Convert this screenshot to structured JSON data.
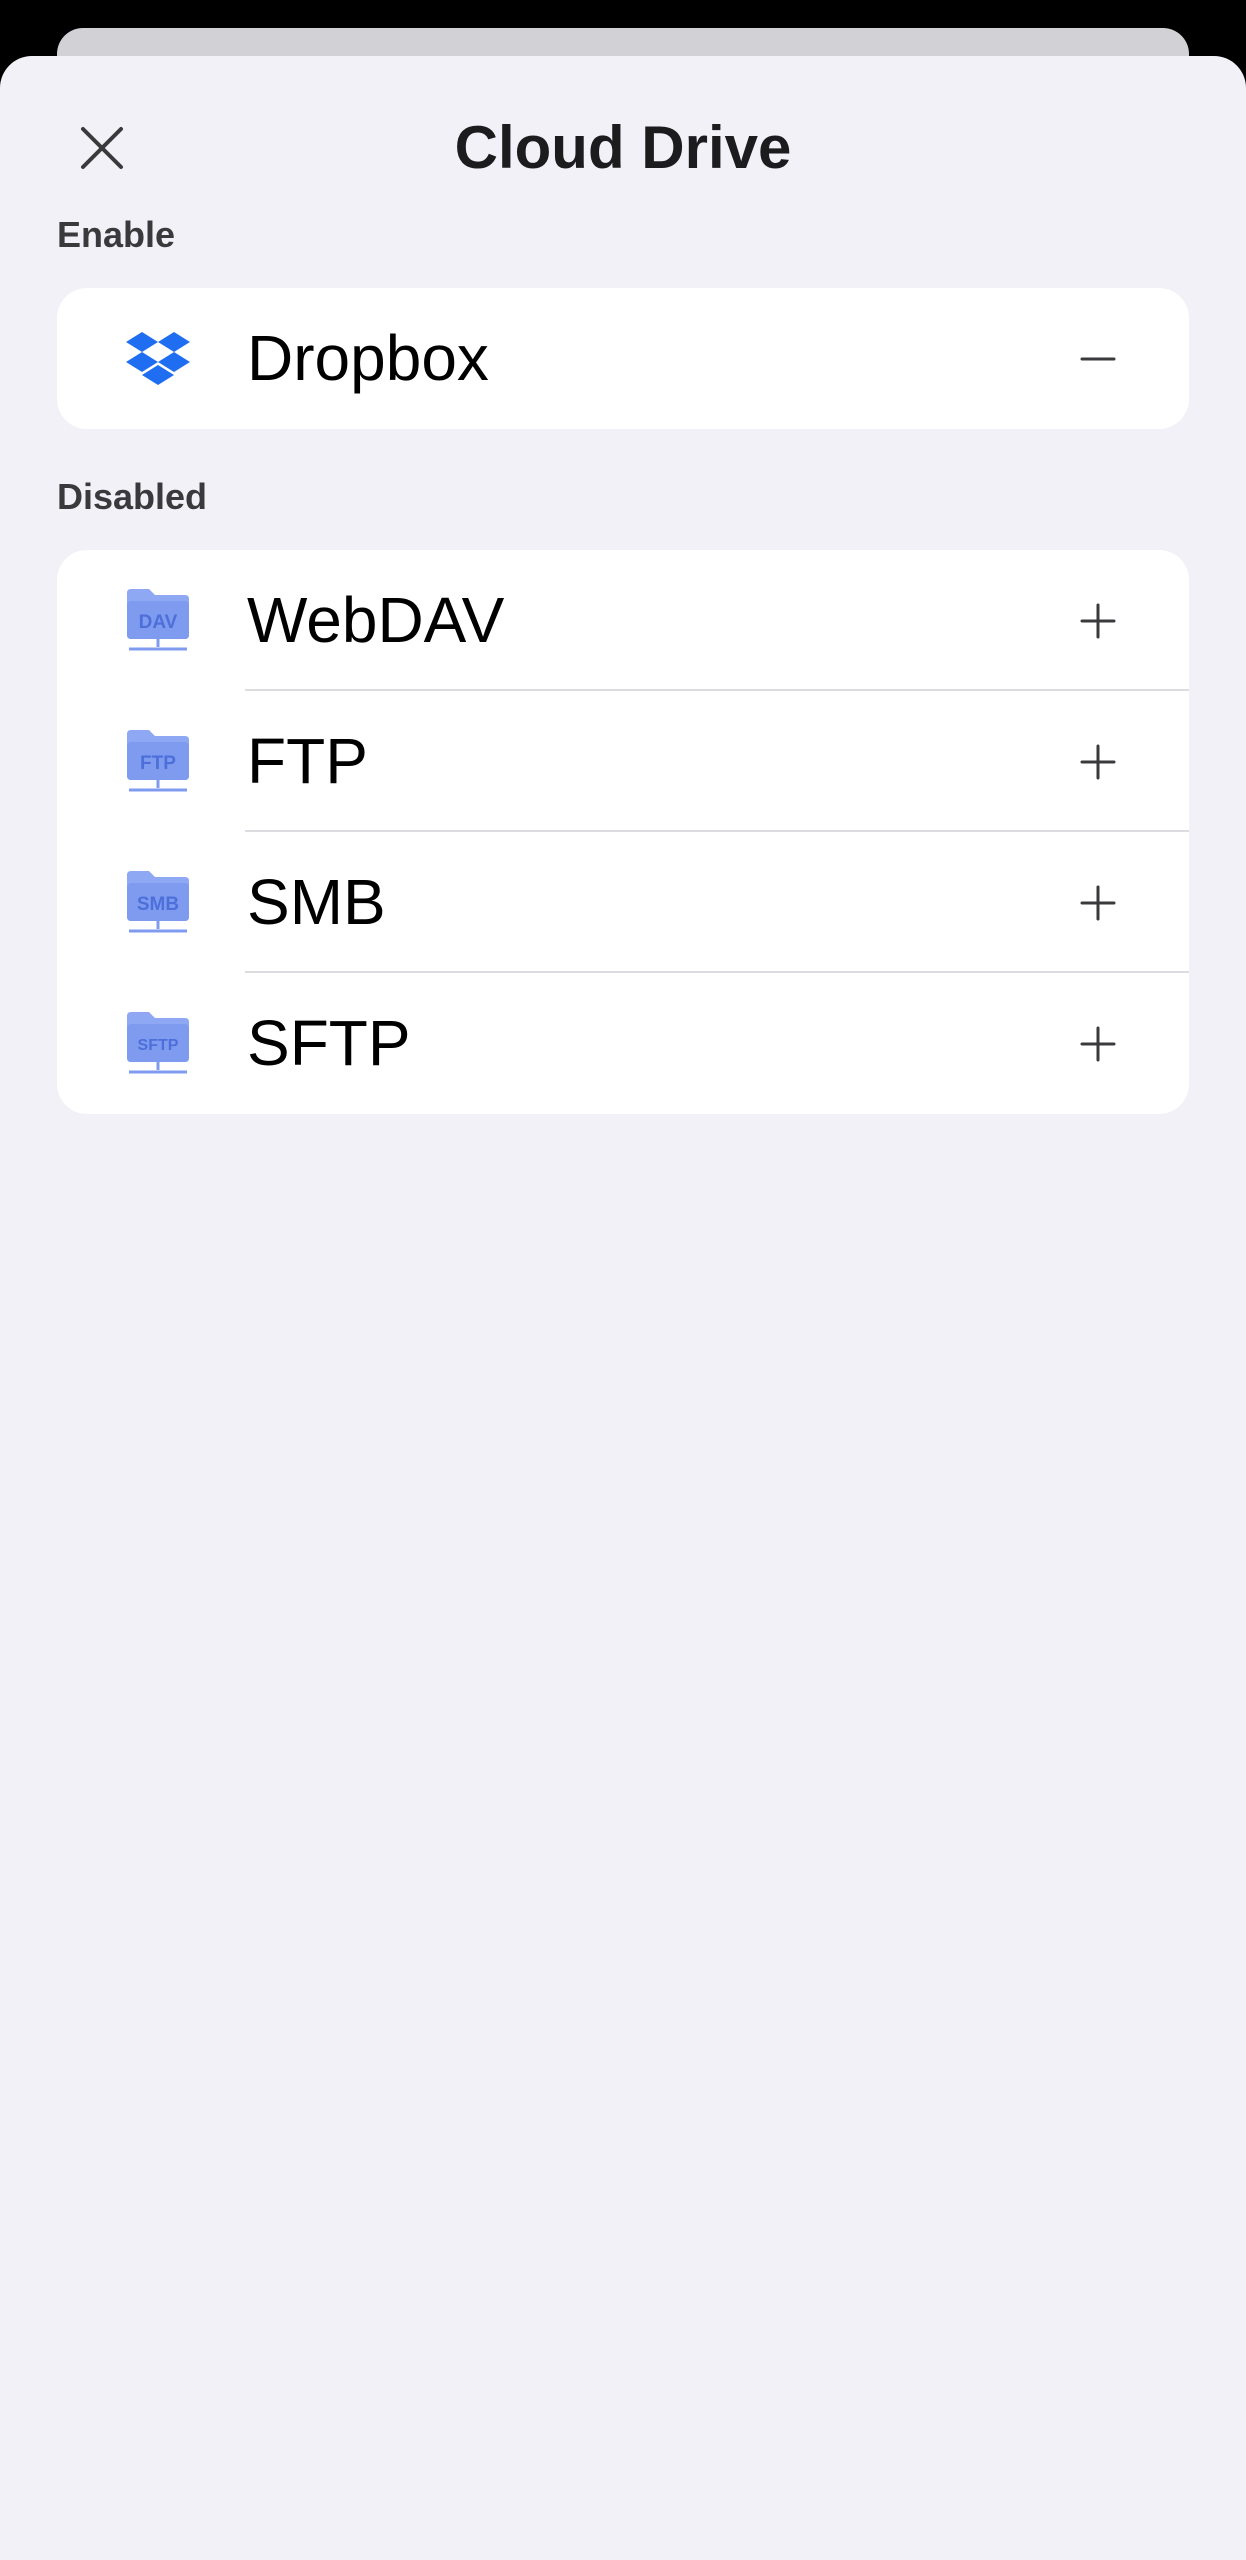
{
  "sheet": {
    "title": "Cloud Drive",
    "close_icon": "close-icon"
  },
  "sections": {
    "enabled": {
      "label": "Enable",
      "items": [
        {
          "name": "Dropbox",
          "icon": "dropbox-icon",
          "action": "minus-icon"
        }
      ]
    },
    "disabled": {
      "label": "Disabled",
      "items": [
        {
          "name": "WebDAV",
          "icon": "webdav-folder-icon",
          "badge": "DAV",
          "action": "plus-icon"
        },
        {
          "name": "FTP",
          "icon": "ftp-folder-icon",
          "badge": "FTP",
          "action": "plus-icon"
        },
        {
          "name": "SMB",
          "icon": "smb-folder-icon",
          "badge": "SMB",
          "action": "plus-icon"
        },
        {
          "name": "SFTP",
          "icon": "sftp-folder-icon",
          "badge": "SFTP",
          "action": "plus-icon"
        }
      ]
    }
  },
  "colors": {
    "sheet_background": "#f1f1f7",
    "card_background": "#ffffff",
    "dropbox_blue": "#1f6ef2",
    "folder_blue": "#7f9bf0",
    "text_primary": "#000000"
  }
}
